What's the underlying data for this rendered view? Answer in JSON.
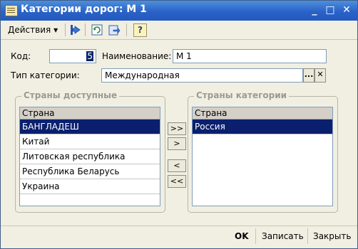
{
  "window": {
    "title": "Категории дорог: М 1",
    "minimize": "_",
    "maximize": "□",
    "close": "✕"
  },
  "toolbar": {
    "actions_label": "Действия",
    "actions_arrow": "▾",
    "help_label": "?"
  },
  "form": {
    "code_label": "Код:",
    "code_value": "5",
    "name_label": "Наименование:",
    "name_value": "М 1",
    "type_label": "Тип категории:",
    "type_value": "Международная",
    "select_btn": "...",
    "clear_btn": "✕"
  },
  "available": {
    "title": "Страны доступные",
    "header": "Страна",
    "rows": [
      "БАНГЛАДЕШ",
      "Китай",
      "Литовская республика",
      "Республика Беларусь",
      "Украина"
    ]
  },
  "category": {
    "title": "Страны категории",
    "header": "Страна",
    "rows": [
      "Россия"
    ]
  },
  "move": {
    "add_all": ">>",
    "add_one": ">",
    "remove_one": "<",
    "remove_all": "<<"
  },
  "buttons": {
    "ok": "OK",
    "save": "Записать",
    "close": "Закрыть"
  }
}
